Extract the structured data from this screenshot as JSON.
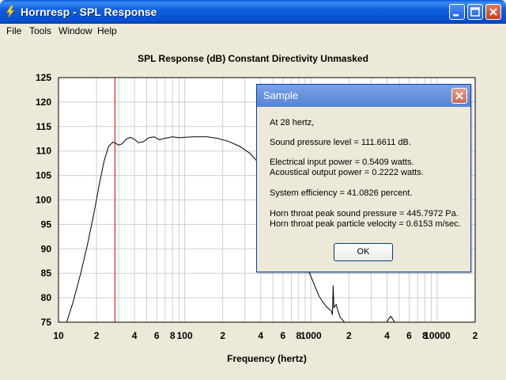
{
  "window": {
    "title": "Hornresp - SPL Response"
  },
  "menu": {
    "items": [
      "File",
      "Tools",
      "Window",
      "Help"
    ]
  },
  "chart_data": {
    "type": "line",
    "title": "SPL Response (dB)   Constant Directivity   Unmasked",
    "xlabel": "Frequency (hertz)",
    "ylabel": "",
    "xscale": "log",
    "xlim": [
      10,
      20000
    ],
    "ylim": [
      75,
      125
    ],
    "yticks": [
      75,
      80,
      85,
      90,
      95,
      100,
      105,
      110,
      115,
      120,
      125
    ],
    "xtick_labels": [
      {
        "x": 10,
        "label": "10"
      },
      {
        "x": 20,
        "label": "2"
      },
      {
        "x": 40,
        "label": "4"
      },
      {
        "x": 60,
        "label": "6"
      },
      {
        "x": 80,
        "label": "8"
      },
      {
        "x": 100,
        "label": "100"
      },
      {
        "x": 200,
        "label": "2"
      },
      {
        "x": 400,
        "label": "4"
      },
      {
        "x": 600,
        "label": "6"
      },
      {
        "x": 800,
        "label": "8"
      },
      {
        "x": 1000,
        "label": "1000"
      },
      {
        "x": 2000,
        "label": "2"
      },
      {
        "x": 4000,
        "label": "4"
      },
      {
        "x": 6000,
        "label": "6"
      },
      {
        "x": 8000,
        "label": "8"
      },
      {
        "x": 10000,
        "label": "10000"
      },
      {
        "x": 20000,
        "label": "2"
      }
    ],
    "grid": true,
    "marker_frequency": 28,
    "series": [
      {
        "color": "#000000",
        "points": [
          [
            11.6,
            75
          ],
          [
            13,
            79
          ],
          [
            15,
            85
          ],
          [
            17,
            91
          ],
          [
            19,
            97
          ],
          [
            21,
            103
          ],
          [
            23,
            108
          ],
          [
            25,
            111
          ],
          [
            27,
            111.8
          ],
          [
            28,
            111.66
          ],
          [
            30,
            111.2
          ],
          [
            32,
            111.5
          ],
          [
            34,
            112.3
          ],
          [
            37,
            112.8
          ],
          [
            40,
            112.4
          ],
          [
            43,
            111.7
          ],
          [
            47,
            111.9
          ],
          [
            52,
            112.7
          ],
          [
            57,
            112.9
          ],
          [
            63,
            112.3
          ],
          [
            70,
            112.6
          ],
          [
            80,
            112.9
          ],
          [
            90,
            112.7
          ],
          [
            100,
            112.8
          ],
          [
            120,
            112.9
          ],
          [
            150,
            112.9
          ],
          [
            180,
            112.6
          ],
          [
            220,
            112.0
          ],
          [
            270,
            111.0
          ],
          [
            330,
            109.5
          ],
          [
            380,
            107.7
          ],
          [
            420,
            106
          ]
        ]
      },
      {
        "color": "#000000",
        "points": [
          [
            940,
            86
          ],
          [
            1050,
            83
          ],
          [
            1150,
            80.5
          ],
          [
            1250,
            79
          ],
          [
            1350,
            78
          ],
          [
            1450,
            77.3
          ],
          [
            1480,
            76.5
          ],
          [
            1500,
            82.5
          ],
          [
            1520,
            78
          ],
          [
            1580,
            78.6
          ],
          [
            1700,
            76
          ],
          [
            1850,
            75
          ]
        ]
      },
      {
        "color": "#000000",
        "points": [
          [
            4000,
            75
          ],
          [
            4150,
            75.8
          ],
          [
            4300,
            76.2
          ],
          [
            4450,
            75.6
          ],
          [
            4600,
            75
          ]
        ]
      }
    ]
  },
  "dialog": {
    "title": "Sample",
    "lines": [
      "At 28 hertz,",
      "Sound pressure level = 111.6611 dB.",
      "Electrical input power = 0.5409 watts.",
      "Acoustical output power = 0.2222 watts.",
      "System efficiency = 41.0826 percent.",
      "Horn throat peak sound pressure = 445.7972 Pa.",
      "Horn throat peak particle velocity = 0.6153 m/sec."
    ],
    "ok_label": "OK"
  }
}
